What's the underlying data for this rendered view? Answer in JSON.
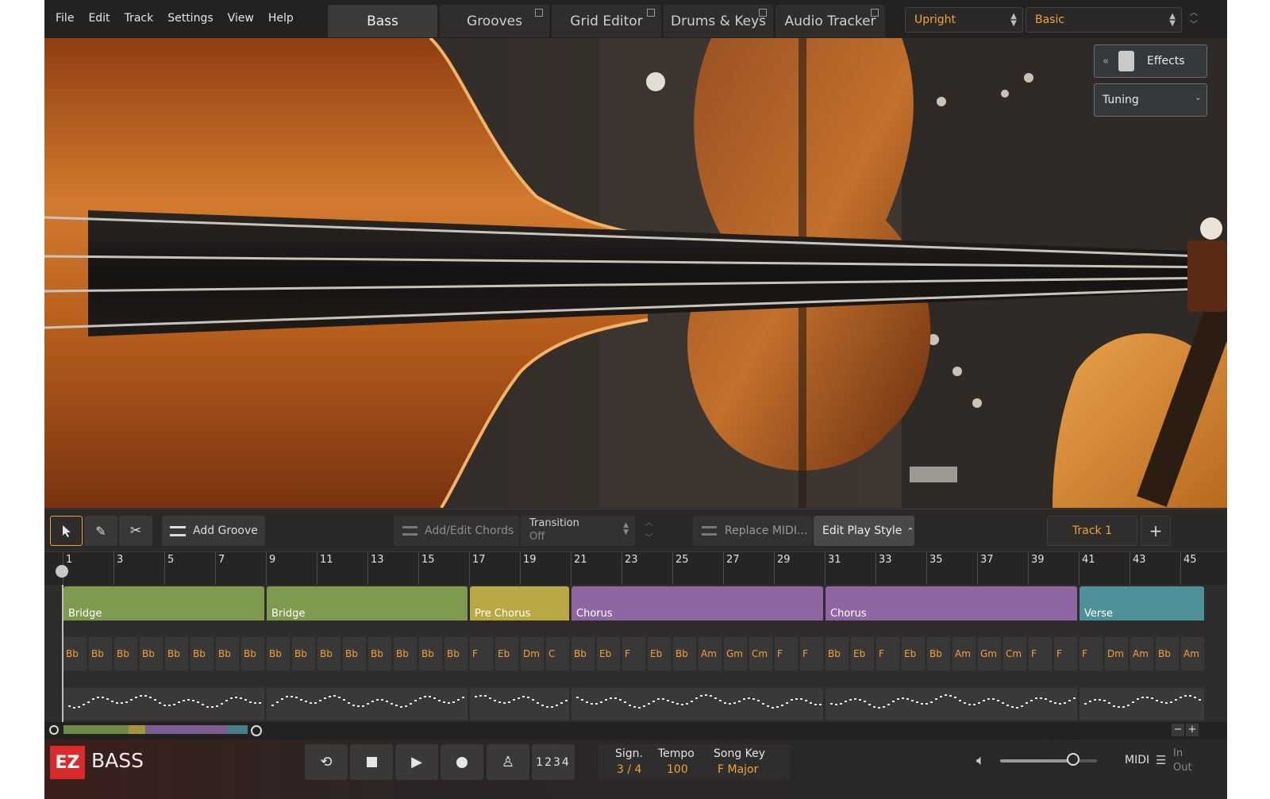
{
  "menu": [
    "File",
    "Edit",
    "Track",
    "Settings",
    "View",
    "Help"
  ],
  "tabs": [
    {
      "label": "Bass",
      "active": true
    },
    {
      "label": "Grooves",
      "active": false
    },
    {
      "label": "Grid Editor",
      "active": false
    },
    {
      "label": "Drums & Keys",
      "active": false
    },
    {
      "label": "Audio Tracker",
      "active": false
    }
  ],
  "instrument_select": "Upright",
  "preset_select": "Basic",
  "effects_label": "Effects",
  "tuning_label": "Tuning",
  "toolbar": {
    "add_groove": "Add Groove",
    "add_edit_chords": "Add/Edit Chords",
    "transition_label": "Transition",
    "transition_value": "Off",
    "replace_midi": "Replace MIDI...",
    "edit_play_style": "Edit Play Style",
    "track_name": "Track 1",
    "add_track": "+"
  },
  "ruler_numbers": [
    "1",
    "3",
    "5",
    "7",
    "9",
    "11",
    "13",
    "15",
    "17",
    "19",
    "21",
    "23",
    "25",
    "27",
    "29",
    "31",
    "33",
    "35",
    "37",
    "39",
    "41",
    "43",
    "45"
  ],
  "parts": [
    {
      "label": "Bridge",
      "color": "#7e9a4f"
    },
    {
      "label": "Bridge",
      "color": "#7e9a4f"
    },
    {
      "label": "Pre Chorus",
      "color": "#b8a944"
    },
    {
      "label": "Chorus",
      "color": "#8d66a2"
    },
    {
      "label": "Chorus",
      "color": "#8d66a2"
    },
    {
      "label": "Verse",
      "color": "#4f9199"
    }
  ],
  "chords": [
    "Bb",
    "Bb",
    "Bb",
    "Bb",
    "Bb",
    "Bb",
    "Bb",
    "Bb",
    "Bb",
    "Bb",
    "Bb",
    "Bb",
    "Bb",
    "Bb",
    "Bb",
    "Bb",
    "F",
    "Eb",
    "Dm",
    "C",
    "Bb",
    "Eb",
    "F",
    "Eb",
    "Bb",
    "Am",
    "Gm",
    "Cm",
    "F",
    "F",
    "Bb",
    "Eb",
    "F",
    "Eb",
    "Bb",
    "Am",
    "Gm",
    "Cm",
    "F",
    "F",
    "F",
    "Dm",
    "Am",
    "Bb",
    "Am"
  ],
  "transport": {
    "count_in": "1234",
    "sign_label": "Sign.",
    "sign_value": "3 / 4",
    "tempo_label": "Tempo",
    "tempo_value": "100",
    "key_label": "Song Key",
    "key_value": "F Major",
    "midi_label": "MIDI",
    "midi_in": "In",
    "midi_out": "Out",
    "volume_level": 0.75
  },
  "logo": {
    "ez": "EZ",
    "bass": "BASS"
  },
  "zoom_minus": "−",
  "zoom_plus": "+"
}
